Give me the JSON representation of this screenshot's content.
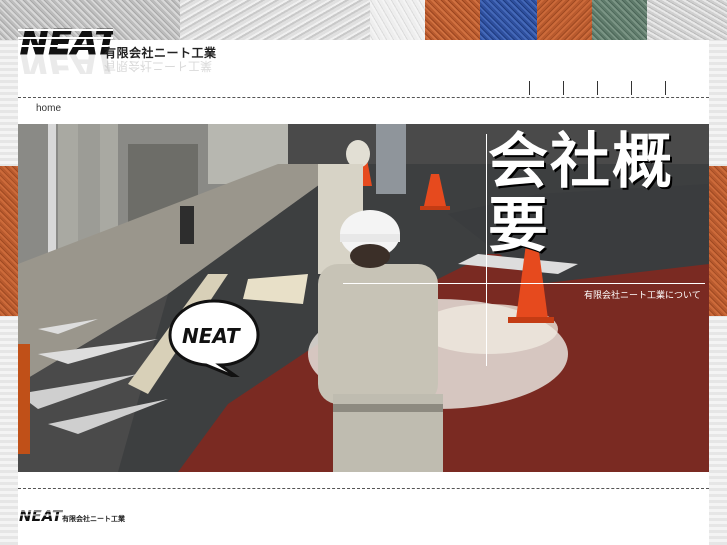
{
  "header": {
    "logo_word": "NEAT",
    "company_name": "有限会社ニート工業"
  },
  "nav": {
    "items": [
      "",
      "",
      "",
      "",
      ""
    ]
  },
  "breadcrumb": {
    "home": "home"
  },
  "hero": {
    "title_line1": "会社概",
    "title_line2": "要",
    "subtitle": "有限会社ニート工業について",
    "bubble_word": "NEAT"
  },
  "footer": {
    "logo_word": "NEAT",
    "company_name": "有限会社ニート工業"
  },
  "colors": {
    "accent_orange": "#b85a2e",
    "accent_blue": "#2e4f9e",
    "accent_green": "#5e7a6a",
    "road_red": "#7a2a22"
  }
}
